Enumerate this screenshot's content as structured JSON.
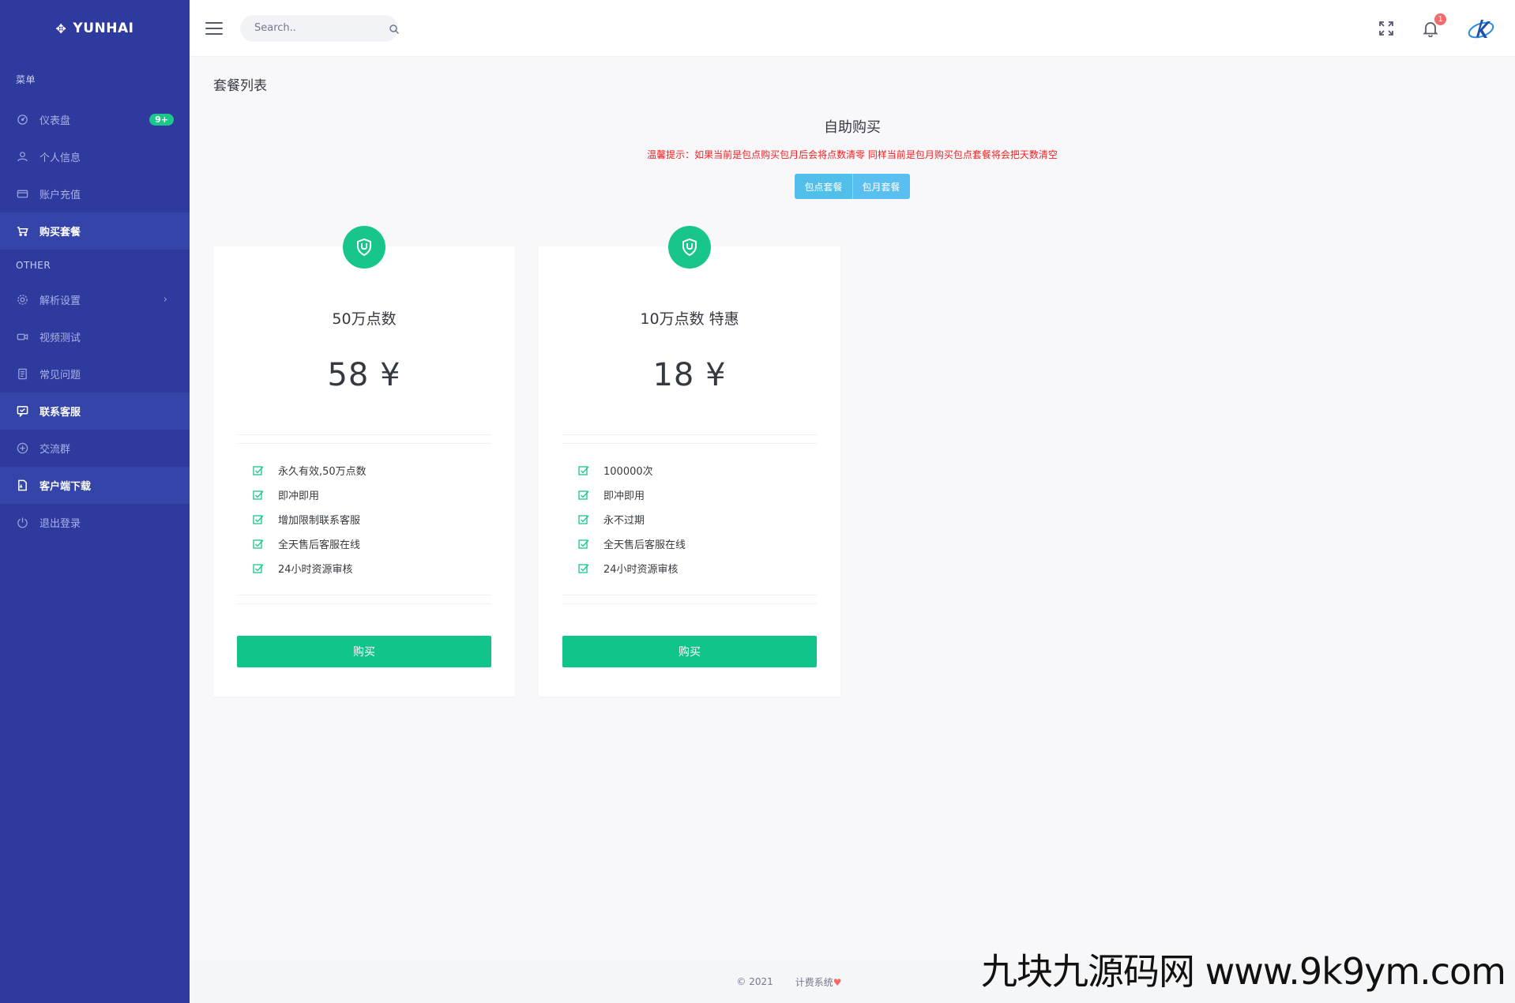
{
  "brand": {
    "name": "YUNHAI",
    "icon": "brand-cross-icon"
  },
  "sidebar": {
    "section_menu": "菜单",
    "section_other": "OTHER",
    "items": [
      {
        "label": "仪表盘",
        "icon": "dashboard-icon",
        "badge": "9+"
      },
      {
        "label": "个人信息",
        "icon": "user-icon"
      },
      {
        "label": "账户充值",
        "icon": "card-icon"
      },
      {
        "label": "购买套餐",
        "icon": "cart-icon",
        "active": true
      },
      {
        "label": "解析设置",
        "icon": "settings-icon",
        "chevron": "›"
      },
      {
        "label": "视频测试",
        "icon": "video-icon"
      },
      {
        "label": "常见问题",
        "icon": "document-icon"
      },
      {
        "label": "联系客服",
        "icon": "chat-icon",
        "active": true
      },
      {
        "label": "交流群",
        "icon": "group-icon"
      },
      {
        "label": "客户端下载",
        "icon": "download-icon",
        "active": true
      },
      {
        "label": "退出登录",
        "icon": "power-icon"
      }
    ]
  },
  "topbar": {
    "search_placeholder": "Search..",
    "notification_count": "1"
  },
  "page": {
    "title": "套餐列表",
    "buy_title": "自助购买",
    "tip": "温馨提示：如果当前是包点购买包月后会将点数清零 同样当前是包月购买包点套餐将会把天数清空",
    "toggle": [
      "包点套餐",
      "包月套餐"
    ]
  },
  "plans": [
    {
      "name": "50万点数",
      "price": "58 ¥",
      "features": [
        "永久有效,50万点数",
        "即冲即用",
        "增加限制联系客服",
        "全天售后客服在线",
        "24小时资源审核"
      ],
      "button": "购买"
    },
    {
      "name": "10万点数 特惠",
      "price": "18 ¥",
      "features": [
        "100000次",
        "即冲即用",
        "永不过期",
        "全天售后客服在线",
        "24小时资源审核"
      ],
      "button": "购买"
    }
  ],
  "footer": {
    "copyright": "© 2021",
    "system": "计费系统"
  },
  "watermark": "九块九源码网 www.9k9ym.com",
  "colors": {
    "sidebar": "#2e3a9e",
    "accent": "#18c68c",
    "tip": "#f31f1f",
    "toggle": "#50c0ea"
  }
}
